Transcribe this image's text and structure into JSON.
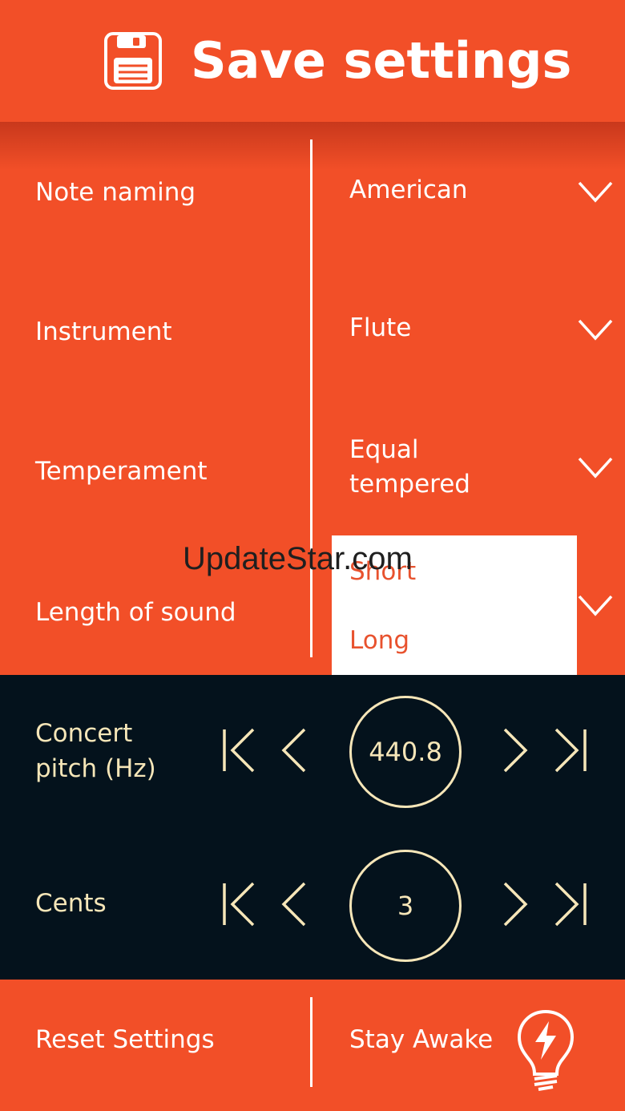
{
  "header": {
    "title": "Save settings",
    "icon": "floppy-disk-icon"
  },
  "settings": [
    {
      "label": "Note naming",
      "value": "American"
    },
    {
      "label": "Instrument",
      "value": "Flute"
    },
    {
      "label": "Temperament",
      "value_line1": "Equal",
      "value_line2": "tempered"
    },
    {
      "label": "Length of sound"
    }
  ],
  "dropdown": {
    "options": [
      "Short",
      "Long"
    ]
  },
  "watermark": "UpdateStar.com",
  "tuning": {
    "concert_pitch": {
      "label_line1": "Concert",
      "label_line2": "pitch (Hz)",
      "value": "440.8"
    },
    "cents": {
      "label": "Cents",
      "value": "3"
    }
  },
  "footer": {
    "reset_label": "Reset Settings",
    "stay_awake_label": "Stay Awake",
    "stay_awake_icon": "lightbulb-icon"
  },
  "colors": {
    "primary": "#f24f28",
    "dark": "#04121c",
    "accent_text": "#f6e6b8",
    "dropdown_text": "#e8522e"
  }
}
